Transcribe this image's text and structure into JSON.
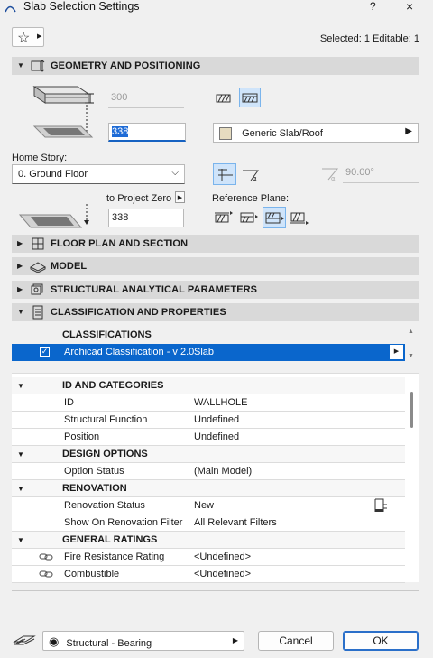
{
  "window": {
    "title": "Slab Selection Settings",
    "help_label": "?",
    "close_label": "×"
  },
  "toolbar": {
    "selected_info": "Selected: 1 Editable: 1"
  },
  "geometry": {
    "header": "GEOMETRY AND POSITIONING",
    "top_offset_value": "300",
    "thickness_value": "338",
    "home_story_label": "Home Story:",
    "home_story_value": "0. Ground Floor",
    "to_project_zero_label": "to Project Zero",
    "elevation_value": "338",
    "material_value": "Generic Slab/Roof",
    "angle_value": "90.00°",
    "reference_plane_label": "Reference Plane:"
  },
  "sections": {
    "floor_plan": "FLOOR PLAN AND SECTION",
    "model": "MODEL",
    "structural": "STRUCTURAL ANALYTICAL PARAMETERS",
    "classification": "CLASSIFICATION AND PROPERTIES"
  },
  "classifications": {
    "header": "CLASSIFICATIONS",
    "row_name": "Archicad Classification - v 2.0",
    "row_value": "Slab"
  },
  "properties": {
    "id_group": "ID AND CATEGORIES",
    "id_label": "ID",
    "id_value": "WALLHOLE",
    "structural_function_label": "Structural Function",
    "structural_function_value": "Undefined",
    "position_label": "Position",
    "position_value": "Undefined",
    "design_group": "DESIGN OPTIONS",
    "option_status_label": "Option Status",
    "option_status_value": "(Main Model)",
    "renovation_group": "RENOVATION",
    "renovation_status_label": "Renovation Status",
    "renovation_status_value": "New",
    "renovation_filter_label": "Show On Renovation Filter",
    "renovation_filter_value": "All Relevant Filters",
    "ratings_group": "GENERAL RATINGS",
    "fire_label": "Fire Resistance Rating",
    "fire_value": "<Undefined>",
    "combustible_label": "Combustible",
    "combustible_value": "<Undefined>"
  },
  "footer": {
    "layer_value": "Structural - Bearing",
    "cancel_label": "Cancel",
    "ok_label": "OK"
  }
}
